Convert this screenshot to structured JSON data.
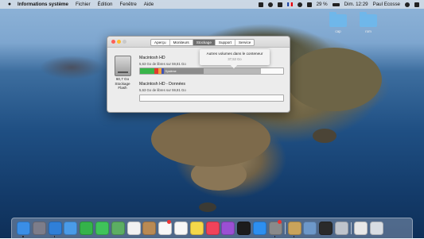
{
  "menubar": {
    "app_name": "Informations système",
    "items": [
      "Fichier",
      "Édition",
      "Fenêtre",
      "Aide"
    ],
    "battery": "29 %",
    "clock": "Dim. 12:29",
    "user": "Paul Ecosse"
  },
  "desktop": {
    "folders": [
      "cap",
      "rom"
    ]
  },
  "window": {
    "tabs": [
      "Aperçu",
      "Moniteurs",
      "Stockage",
      "Support",
      "Service"
    ],
    "active_tab": "Stockage",
    "disk": {
      "size": "60,7 Go",
      "type": "Stockage Flash"
    },
    "volumes": [
      {
        "name": "Macintosh HD",
        "free": "5,63 Go de libres sur 59,81 Go",
        "segments": [
          {
            "label": "",
            "color": "#39b54a",
            "fraction": 0.1
          },
          {
            "label": "",
            "color": "#e23a2e",
            "fraction": 0.03
          },
          {
            "label": "",
            "color": "#f2a23a",
            "fraction": 0.02
          },
          {
            "label": "",
            "color": "#3f51b5",
            "fraction": 0.015
          },
          {
            "label": "Système",
            "color": "#8c8c8c",
            "fraction": 0.28
          },
          {
            "label": "",
            "color": "#b8b8b8",
            "fraction": 0.4
          },
          {
            "label": "",
            "color": "#fbfbfb",
            "fraction": 0.155
          }
        ]
      },
      {
        "name": "Macintosh HD - Données",
        "free": "5,63 Go de libres sur 59,81 Go",
        "segments": [
          {
            "label": "",
            "color": "#fbfbfb",
            "fraction": 1.0
          }
        ]
      }
    ],
    "tooltip": {
      "title": "Autres volumes dans le conteneur",
      "value": "37,53 Go"
    }
  },
  "dock": {
    "apps": [
      {
        "name": "finder-icon",
        "color": "#3a8ee6",
        "running": true
      },
      {
        "name": "launchpad-icon",
        "color": "#7d7d8a",
        "running": false
      },
      {
        "name": "safari-icon",
        "color": "#2f7fd8",
        "running": true
      },
      {
        "name": "mail-icon",
        "color": "#4a9be8",
        "running": false
      },
      {
        "name": "facetime-icon",
        "color": "#34b34a",
        "running": false
      },
      {
        "name": "messages-icon",
        "color": "#3fc35a",
        "running": false
      },
      {
        "name": "maps-icon",
        "color": "#5cae63",
        "running": false
      },
      {
        "name": "photos-icon",
        "color": "#f2f2f2",
        "running": false
      },
      {
        "name": "contacts-icon",
        "color": "#b98a54",
        "running": false
      },
      {
        "name": "calendar-icon",
        "color": "#f7f7f7",
        "running": false
      },
      {
        "name": "reminders-icon",
        "color": "#f7f7f7",
        "running": false
      },
      {
        "name": "notes-icon",
        "color": "#f5d84a",
        "running": false
      },
      {
        "name": "music-icon",
        "color": "#f0435a",
        "running": false
      },
      {
        "name": "podcasts-icon",
        "color": "#9b4fd4",
        "running": false
      },
      {
        "name": "tv-icon",
        "color": "#1c1c1c",
        "running": false
      },
      {
        "name": "app-store-icon",
        "color": "#2d8ff0",
        "running": false
      },
      {
        "name": "system-preferences-icon",
        "color": "#8a8a8a",
        "running": true
      },
      {
        "name": "system-information-icon",
        "color": "#c9a35b",
        "running": true
      },
      {
        "name": "utilities-icon",
        "color": "#6d98c9",
        "running": false
      },
      {
        "name": "terminal-icon",
        "color": "#2a2a2a",
        "running": false
      },
      {
        "name": "screenshot-icon",
        "color": "#bfc4cc",
        "running": false
      },
      {
        "name": "downloads-icon",
        "color": "#e8e8e8",
        "running": false
      },
      {
        "name": "trash-icon",
        "color": "#d8dde3",
        "running": false
      }
    ],
    "badges": [
      "calendar-icon",
      "system-preferences-icon"
    ]
  },
  "colors": {
    "accent": "#6f6f6f",
    "window_bg": "#ececec"
  }
}
